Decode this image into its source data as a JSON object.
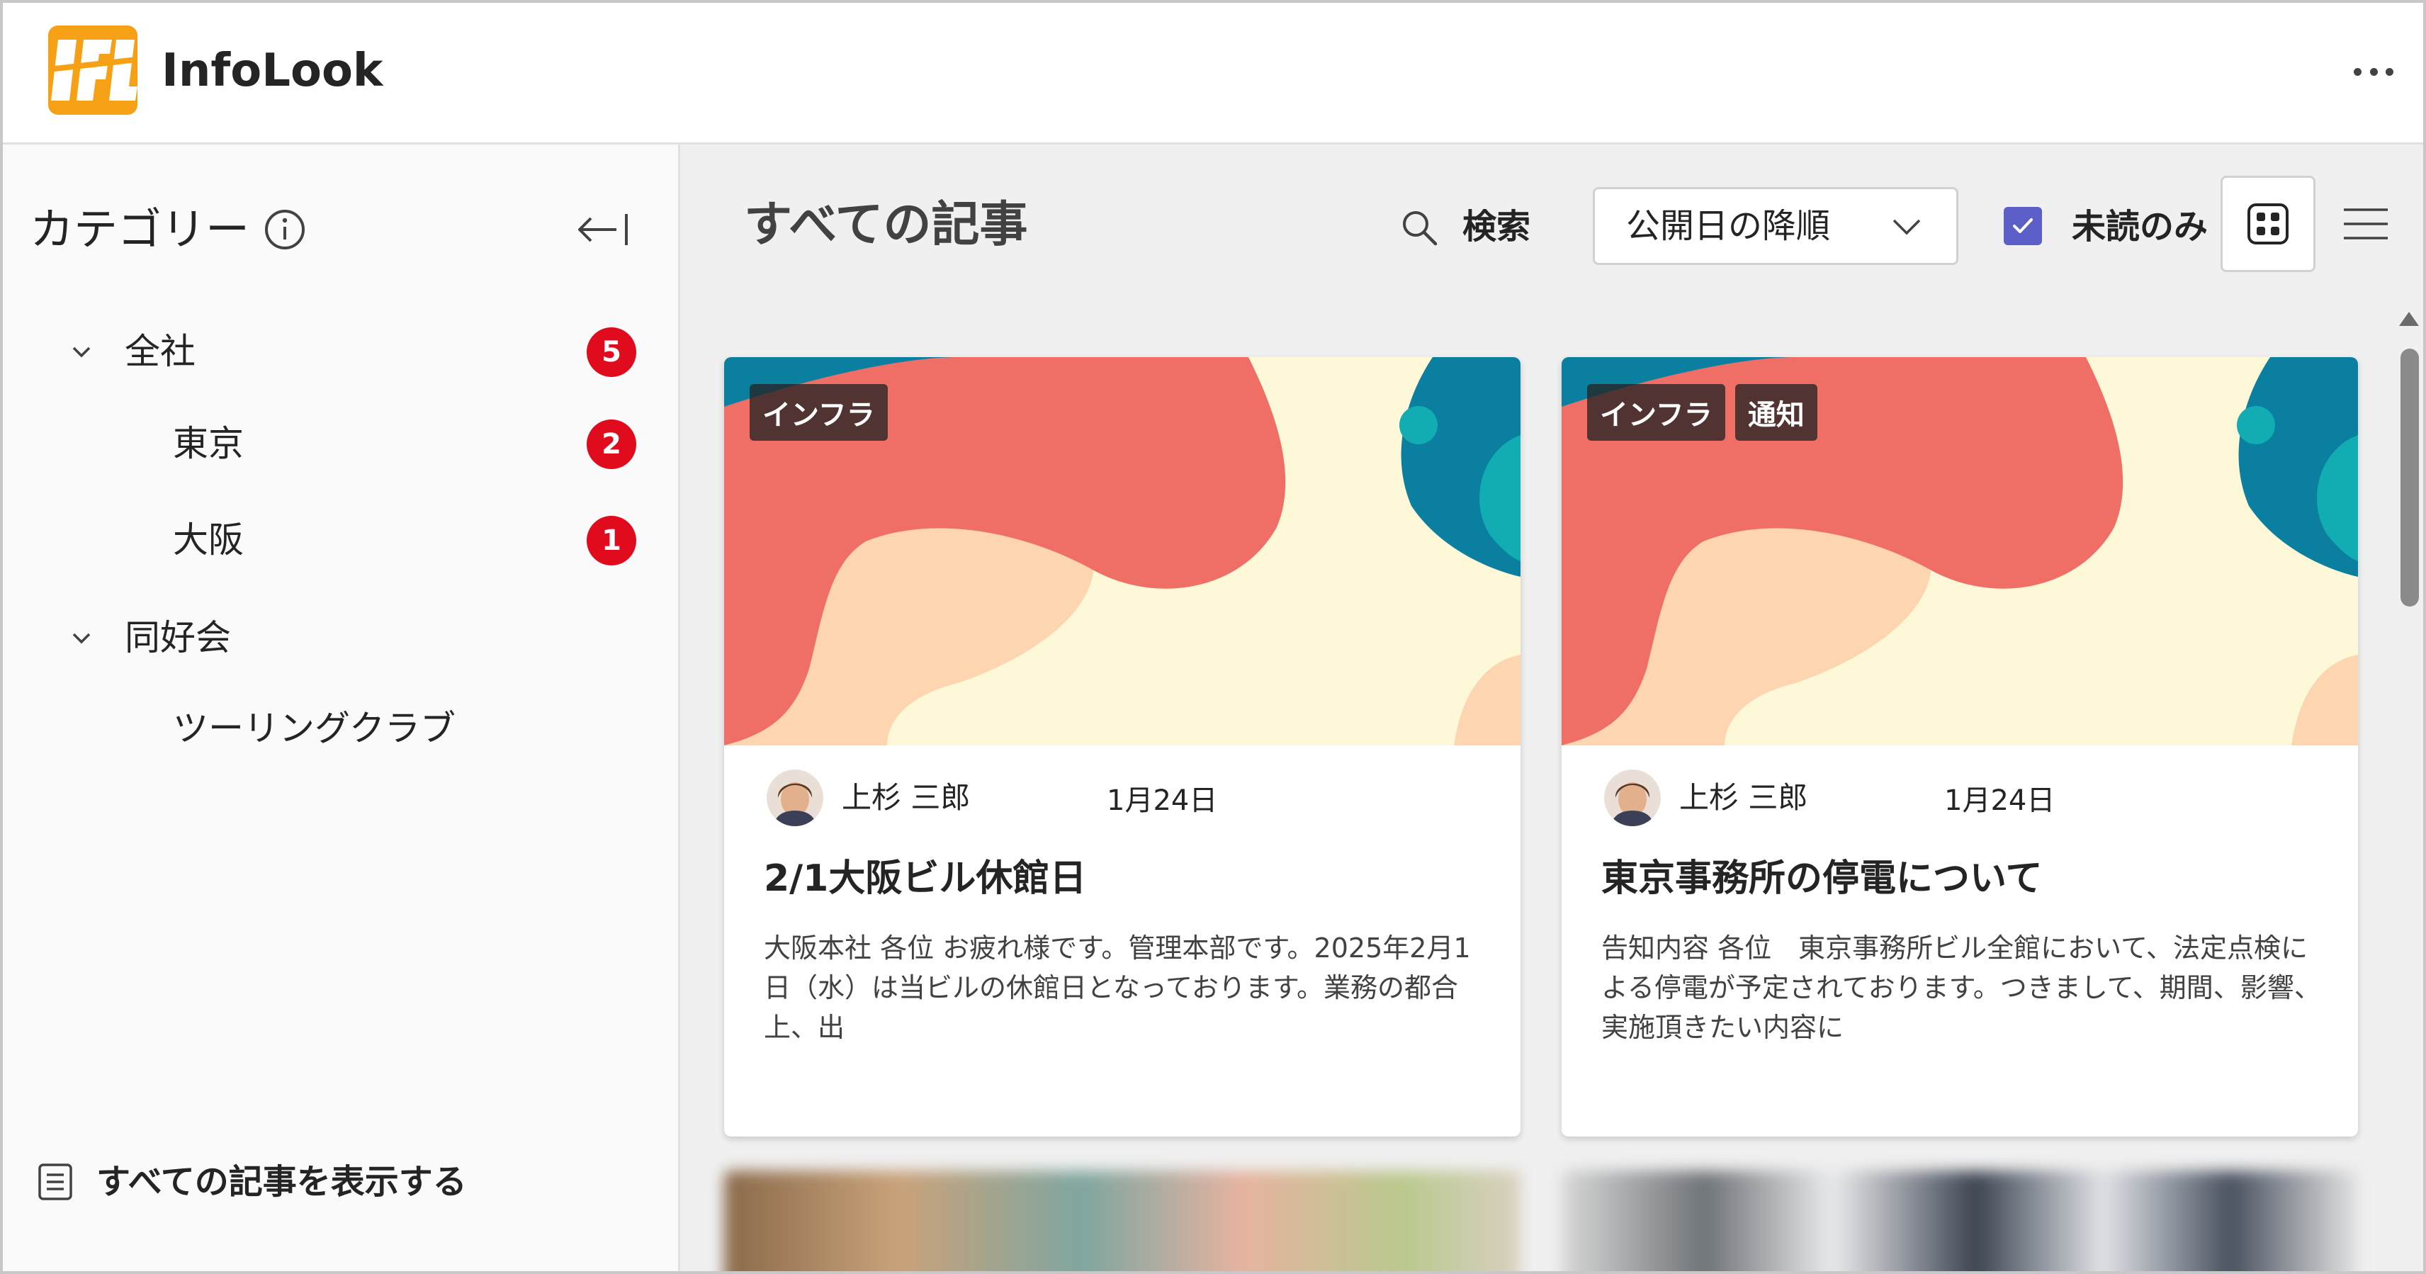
{
  "header": {
    "app_title": "InfoLook",
    "logo_text": "IFL",
    "more_icon": "more-horizontal-icon"
  },
  "sidebar": {
    "title": "カテゴリー",
    "info_icon": "info-icon",
    "collapse_icon": "collapse-left-icon",
    "groups": [
      {
        "label": "全社",
        "badge": "5",
        "expanded": true,
        "children": [
          {
            "label": "東京",
            "badge": "2"
          },
          {
            "label": "大阪",
            "badge": "1"
          }
        ]
      },
      {
        "label": "同好会",
        "badge": "",
        "expanded": true,
        "children": [
          {
            "label": "ツーリングクラブ",
            "badge": ""
          }
        ]
      }
    ],
    "show_all_label": "すべての記事を表示する"
  },
  "main": {
    "title": "すべての記事",
    "search_label": "検索",
    "sort_selected": "公開日の降順",
    "unread_only_label": "未読のみ",
    "unread_only_checked": true,
    "accent_color": "#5b5fc7",
    "badge_color": "#e00b1c",
    "cards": [
      {
        "tags": [
          "インフラ"
        ],
        "author": "上杉 三郎",
        "date": "1月24日",
        "title": "2/1大阪ビル休館日",
        "excerpt": "大阪本社 各位 お疲れ様です。管理本部です。2025年2月1日（水）は当ビルの休館日となっております。業務の都合上、出"
      },
      {
        "tags": [
          "インフラ",
          "通知"
        ],
        "author": "上杉 三郎",
        "date": "1月24日",
        "title": "東京事務所の停電について",
        "excerpt": "告知内容 各位　東京事務所ビル全館において、法定点検による停電が予定されております。つきまして、期間、影響、実施頂きたい内容に"
      }
    ]
  }
}
